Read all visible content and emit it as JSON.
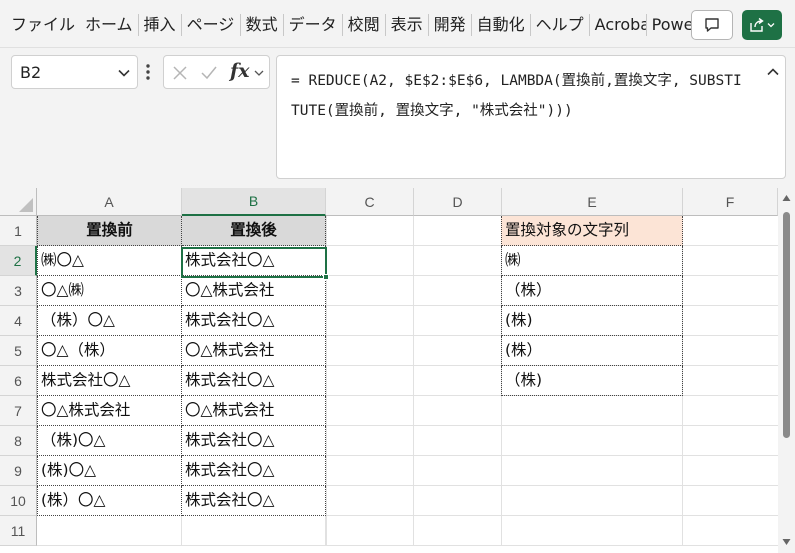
{
  "ribbon": {
    "tabs": [
      "ファイル",
      "ホーム",
      "挿入",
      "ページ",
      "数式",
      "データ",
      "校閲",
      "表示",
      "開発",
      "自動化",
      "ヘルプ",
      "Acrobat",
      "Power"
    ]
  },
  "formula_bar": {
    "name_box": "B2",
    "fx_label": "fx",
    "formula": "= REDUCE(A2, $E$2:$E$6, LAMBDA(置換前,置換文字, SUBSTITUTE(置換前, 置換文字, \"株式会社\")))"
  },
  "grid": {
    "columns": [
      "A",
      "B",
      "C",
      "D",
      "E",
      "F"
    ],
    "rows": [
      "1",
      "2",
      "3",
      "4",
      "5",
      "6",
      "7",
      "8",
      "9",
      "10",
      "11"
    ],
    "col_a": [
      "置換前",
      "㈱〇△",
      "〇△㈱",
      "（株）〇△",
      "〇△（株）",
      "株式会社〇△",
      "〇△株式会社",
      "（株)〇△",
      "(株)〇△",
      "(株）〇△"
    ],
    "col_b": [
      "置換後",
      "株式会社〇△",
      "〇△株式会社",
      "株式会社〇△",
      "〇△株式会社",
      "株式会社〇△",
      "〇△株式会社",
      "株式会社〇△",
      "株式会社〇△",
      "株式会社〇△"
    ],
    "col_e": [
      "置換対象の文字列",
      "㈱",
      "（株）",
      "(株)",
      "(株）",
      "（株)"
    ]
  },
  "colors": {
    "accent": "#1e7145",
    "header_fill": "#d9d9d9",
    "e_header_fill": "#fce4d6"
  }
}
